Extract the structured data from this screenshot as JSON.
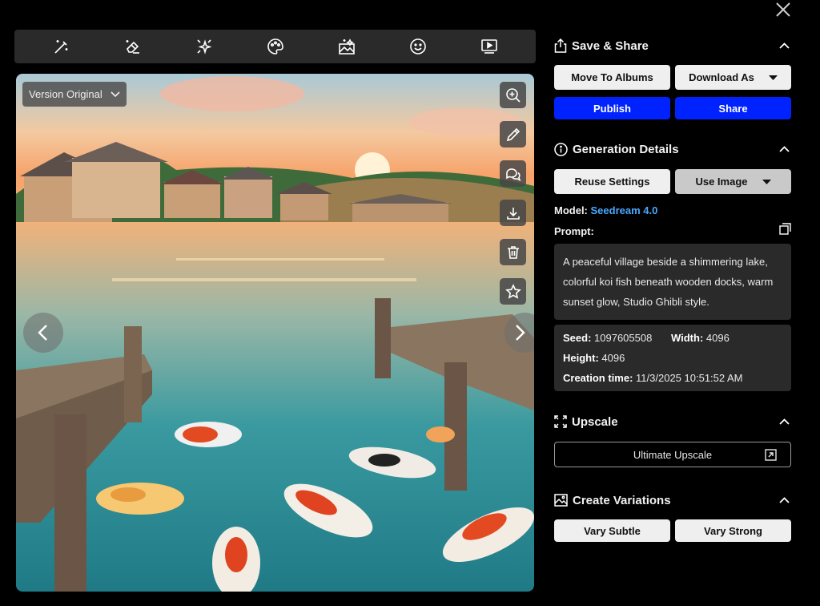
{
  "toolbar": {
    "tools": [
      "magic-wand-icon",
      "eraser-icon",
      "sparkles-icon",
      "palette-icon",
      "image-enhance-icon",
      "smiley-icon",
      "video-icon"
    ]
  },
  "viewer": {
    "version_label": "Version Original"
  },
  "save_share": {
    "title": "Save & Share",
    "move_to_albums": "Move To Albums",
    "download_as": "Download As",
    "publish": "Publish",
    "share": "Share"
  },
  "generation": {
    "title": "Generation Details",
    "reuse_settings": "Reuse Settings",
    "use_image": "Use Image",
    "model_label": "Model:",
    "model_value": "Seedream 4.0",
    "prompt_label": "Prompt:",
    "prompt_text": "A peaceful village beside a shimmering lake, colorful koi fish beneath wooden docks, warm sunset glow, Studio Ghibli style.",
    "seed_label": "Seed:",
    "seed_value": "1097605508",
    "width_label": "Width:",
    "width_value": "4096",
    "height_label": "Height:",
    "height_value": "4096",
    "creation_label": "Creation time:",
    "creation_value": "11/3/2025 10:51:52 AM"
  },
  "upscale": {
    "title": "Upscale",
    "ultimate": "Ultimate Upscale"
  },
  "variations": {
    "title": "Create Variations",
    "subtle": "Vary Subtle",
    "strong": "Vary Strong"
  },
  "colors": {
    "accent_blue": "#0022ff",
    "link_blue": "#4aa8ff",
    "panel_bg": "#2a2a2a"
  }
}
